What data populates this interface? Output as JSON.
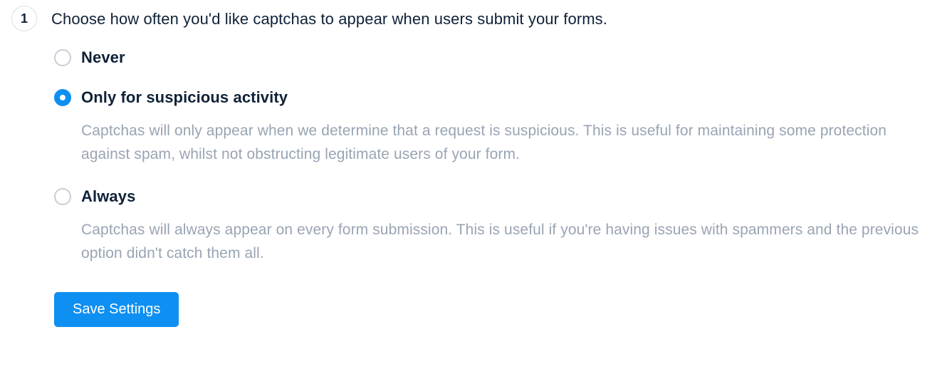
{
  "step": {
    "number": "1",
    "title": "Choose how often you'd like captchas to appear when users submit your forms."
  },
  "options": {
    "never": {
      "label": "Never"
    },
    "suspicious": {
      "label": "Only for suspicious activity",
      "desc": "Captchas will only appear when we determine that a request is suspicious. This is useful for maintaining some protection against spam, whilst not obstructing legitimate users of your form."
    },
    "always": {
      "label": "Always",
      "desc": "Captchas will always appear on every form submission. This is useful if you're having issues with spammers and the previous option didn't catch them all."
    }
  },
  "actions": {
    "save_label": "Save Settings"
  }
}
